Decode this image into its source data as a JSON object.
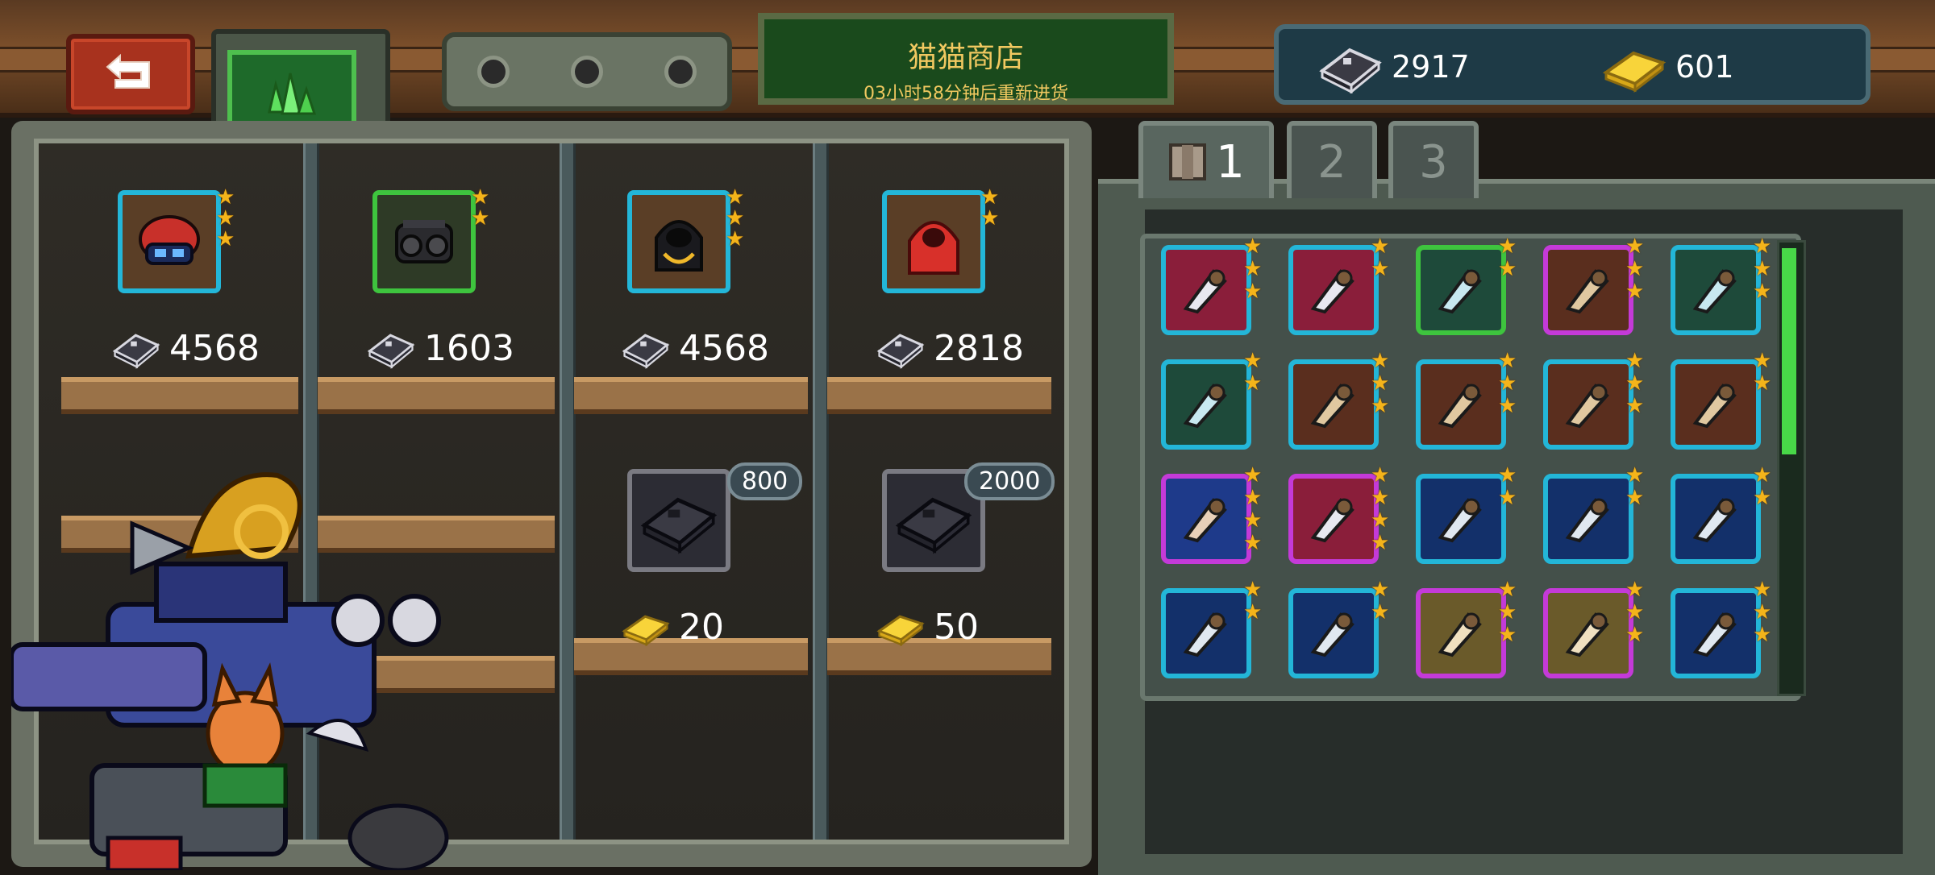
{
  "header": {
    "shop_title": "猫猫商店",
    "restock_text": "03小时58分钟后重新进货",
    "back_icon": "back-arrow-icon",
    "tab_icon": "green-crystal-icon"
  },
  "currency": {
    "chips": "2917",
    "gold": "601"
  },
  "shop": {
    "items": [
      {
        "icon": "red-helmet-icon",
        "rarity": "cyan",
        "stars": 3,
        "price": "4568",
        "price_currency": "chip"
      },
      {
        "icon": "goggles-mask-icon",
        "rarity": "green",
        "stars": 2,
        "price": "1603",
        "price_currency": "chip"
      },
      {
        "icon": "black-hood-gold-chain-icon",
        "rarity": "cyan",
        "stars": 3,
        "price": "4568",
        "price_currency": "chip"
      },
      {
        "icon": "red-hoodie-icon",
        "rarity": "cyan",
        "stars": 2,
        "price": "2818",
        "price_currency": "chip"
      }
    ],
    "bundles": [
      {
        "icon": "chip-bundle-icon",
        "amount": "800",
        "price": "20",
        "price_currency": "gold"
      },
      {
        "icon": "chip-bundle-icon",
        "amount": "2000",
        "price": "50",
        "price_currency": "gold"
      }
    ]
  },
  "inventory": {
    "tabs": [
      {
        "label": "1",
        "active": true,
        "icon": "crate-icon"
      },
      {
        "label": "2",
        "active": false
      },
      {
        "label": "3",
        "active": false
      }
    ],
    "rows": [
      [
        {
          "icon": "green-blaster-icon",
          "rarity": "cyan",
          "bg": "red",
          "stars": 3
        },
        {
          "icon": "orange-crossbow-icon",
          "rarity": "cyan",
          "bg": "red",
          "stars": 2
        },
        {
          "icon": "cyan-drone-icon",
          "rarity": "green",
          "bg": "teal",
          "stars": 2
        },
        {
          "icon": "blue-cannon-icon",
          "rarity": "purple",
          "bg": "brown",
          "stars": 3
        },
        {
          "icon": "gray-turret-icon",
          "rarity": "cyan",
          "bg": "teal",
          "stars": 3
        }
      ],
      [
        {
          "icon": "wooden-club-icon",
          "rarity": "cyan",
          "bg": "teal",
          "stars": 2
        },
        {
          "icon": "crossbow-icon",
          "rarity": "cyan",
          "bg": "brown",
          "stars": 3
        },
        {
          "icon": "crossbow-icon",
          "rarity": "cyan",
          "bg": "brown",
          "stars": 3
        },
        {
          "icon": "camo-helmet-icon",
          "rarity": "cyan",
          "bg": "brown",
          "stars": 3
        },
        {
          "icon": "orange-rifle-icon",
          "rarity": "cyan",
          "bg": "brown",
          "stars": 2
        }
      ],
      [
        {
          "icon": "claw-glove-icon",
          "rarity": "purple",
          "bg": "blue",
          "stars": 4
        },
        {
          "icon": "pickaxe-icon",
          "rarity": "purple",
          "bg": "red",
          "stars": 4
        },
        {
          "icon": "steel-claw-icon",
          "rarity": "cyan",
          "bg": "dkblue",
          "stars": 2
        },
        {
          "icon": "claw-glove-icon",
          "rarity": "cyan",
          "bg": "dkblue",
          "stars": 2
        },
        {
          "icon": "claw-glove-icon",
          "rarity": "cyan",
          "bg": "dkblue",
          "stars": 2
        }
      ],
      [
        {
          "icon": "steel-claw-icon",
          "rarity": "cyan",
          "bg": "dkblue",
          "stars": 2
        },
        {
          "icon": "steel-claw-icon",
          "rarity": "cyan",
          "bg": "dkblue",
          "stars": 2
        },
        {
          "icon": "bone-club-icon",
          "rarity": "purple",
          "bg": "gold",
          "stars": 3
        },
        {
          "icon": "bone-club-icon",
          "rarity": "purple",
          "bg": "gold",
          "stars": 3
        },
        {
          "icon": "golden-hammer-icon",
          "rarity": "cyan",
          "bg": "dkblue",
          "stars": 3
        }
      ]
    ]
  },
  "colors": {
    "rarity_cyan": "#23b6d8",
    "rarity_green": "#3ec43e",
    "rarity_purple": "#c43ad8",
    "star": "#f4b41a",
    "title_text": "#f0c860",
    "scroll_thumb": "#48d848"
  }
}
